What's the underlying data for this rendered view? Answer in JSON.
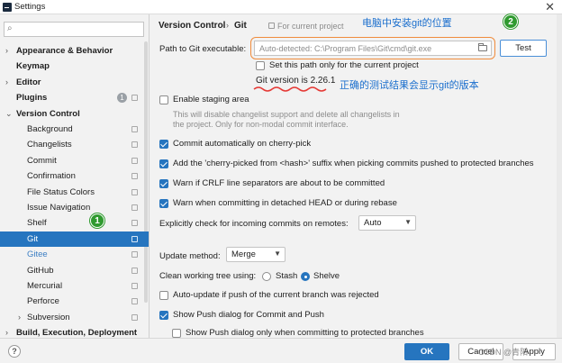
{
  "window": {
    "title": "Settings",
    "close_glyph": "✕"
  },
  "search": {
    "placeholder": "",
    "icon": "search-icon"
  },
  "sidebar": {
    "items": [
      {
        "label": "Appearance & Behavior",
        "bold": true,
        "expand": "collapsed"
      },
      {
        "label": "Keymap",
        "bold": true
      },
      {
        "label": "Editor",
        "bold": true,
        "expand": "collapsed"
      },
      {
        "label": "Plugins",
        "bold": true,
        "badge": "1"
      },
      {
        "label": "Version Control",
        "bold": true,
        "expand": "expanded"
      },
      {
        "label": "Background"
      },
      {
        "label": "Changelists"
      },
      {
        "label": "Commit"
      },
      {
        "label": "Confirmation"
      },
      {
        "label": "File Status Colors"
      },
      {
        "label": "Issue Navigation"
      },
      {
        "label": "Shelf"
      },
      {
        "label": "Git",
        "selected": true
      },
      {
        "label": "Gitee"
      },
      {
        "label": "GitHub"
      },
      {
        "label": "Mercurial"
      },
      {
        "label": "Perforce"
      },
      {
        "label": "Subversion",
        "expand": "collapsed"
      },
      {
        "label": "Build, Execution, Deployment",
        "bold": true,
        "expand": "collapsed"
      }
    ]
  },
  "breadcrumb": {
    "section": "Version Control",
    "separator": "›",
    "page": "Git",
    "scope": "For current project"
  },
  "annotations": {
    "top": "电脑中安装git的位置",
    "middle": "正确的测试结果会显示git的版本",
    "badge1": "1",
    "badge2": "2",
    "accent_orange": "#f08c3c",
    "accent_red": "#e53935",
    "accent_green": "#2f9a2f"
  },
  "git": {
    "path_label": "Path to Git executable:",
    "path_value": "Auto-detected: C:\\Program Files\\Git\\cmd\\git.exe",
    "test_label": "Test",
    "set_path_only": "Set this path only for the current project",
    "version": "Git version is 2.26.1",
    "enable_staging": "Enable staging area",
    "staging_desc_1": "This will disable changelist support and delete all changelists in",
    "staging_desc_2": "the project. Only for non-modal commit interface.",
    "commit_cherry": "Commit automatically on cherry-pick",
    "add_suffix": "Add the 'cherry-picked from <hash>' suffix when picking commits pushed to protected branches",
    "warn_crlf": "Warn if CRLF line separators are about to be committed",
    "warn_detached": "Warn when committing in detached HEAD or during rebase",
    "explicit_check": "Explicitly check for incoming commits on remotes:",
    "explicit_value": "Auto",
    "update_method_label": "Update method:",
    "update_method_value": "Merge",
    "clean_tree_label": "Clean working tree using:",
    "stash": "Stash",
    "shelve": "Shelve",
    "auto_update": "Auto-update if push of the current branch was rejected",
    "show_push": "Show Push dialog for Commit and Push",
    "show_push_protected": "Show Push dialog only when committing to protected branches"
  },
  "footer": {
    "help": "?",
    "ok": "OK",
    "cancel": "Cancel",
    "apply": "Apply",
    "watermark": "CSDN @青阳"
  },
  "colors": {
    "selection": "#2675bf",
    "annotation_text": "#1a6ecd"
  }
}
